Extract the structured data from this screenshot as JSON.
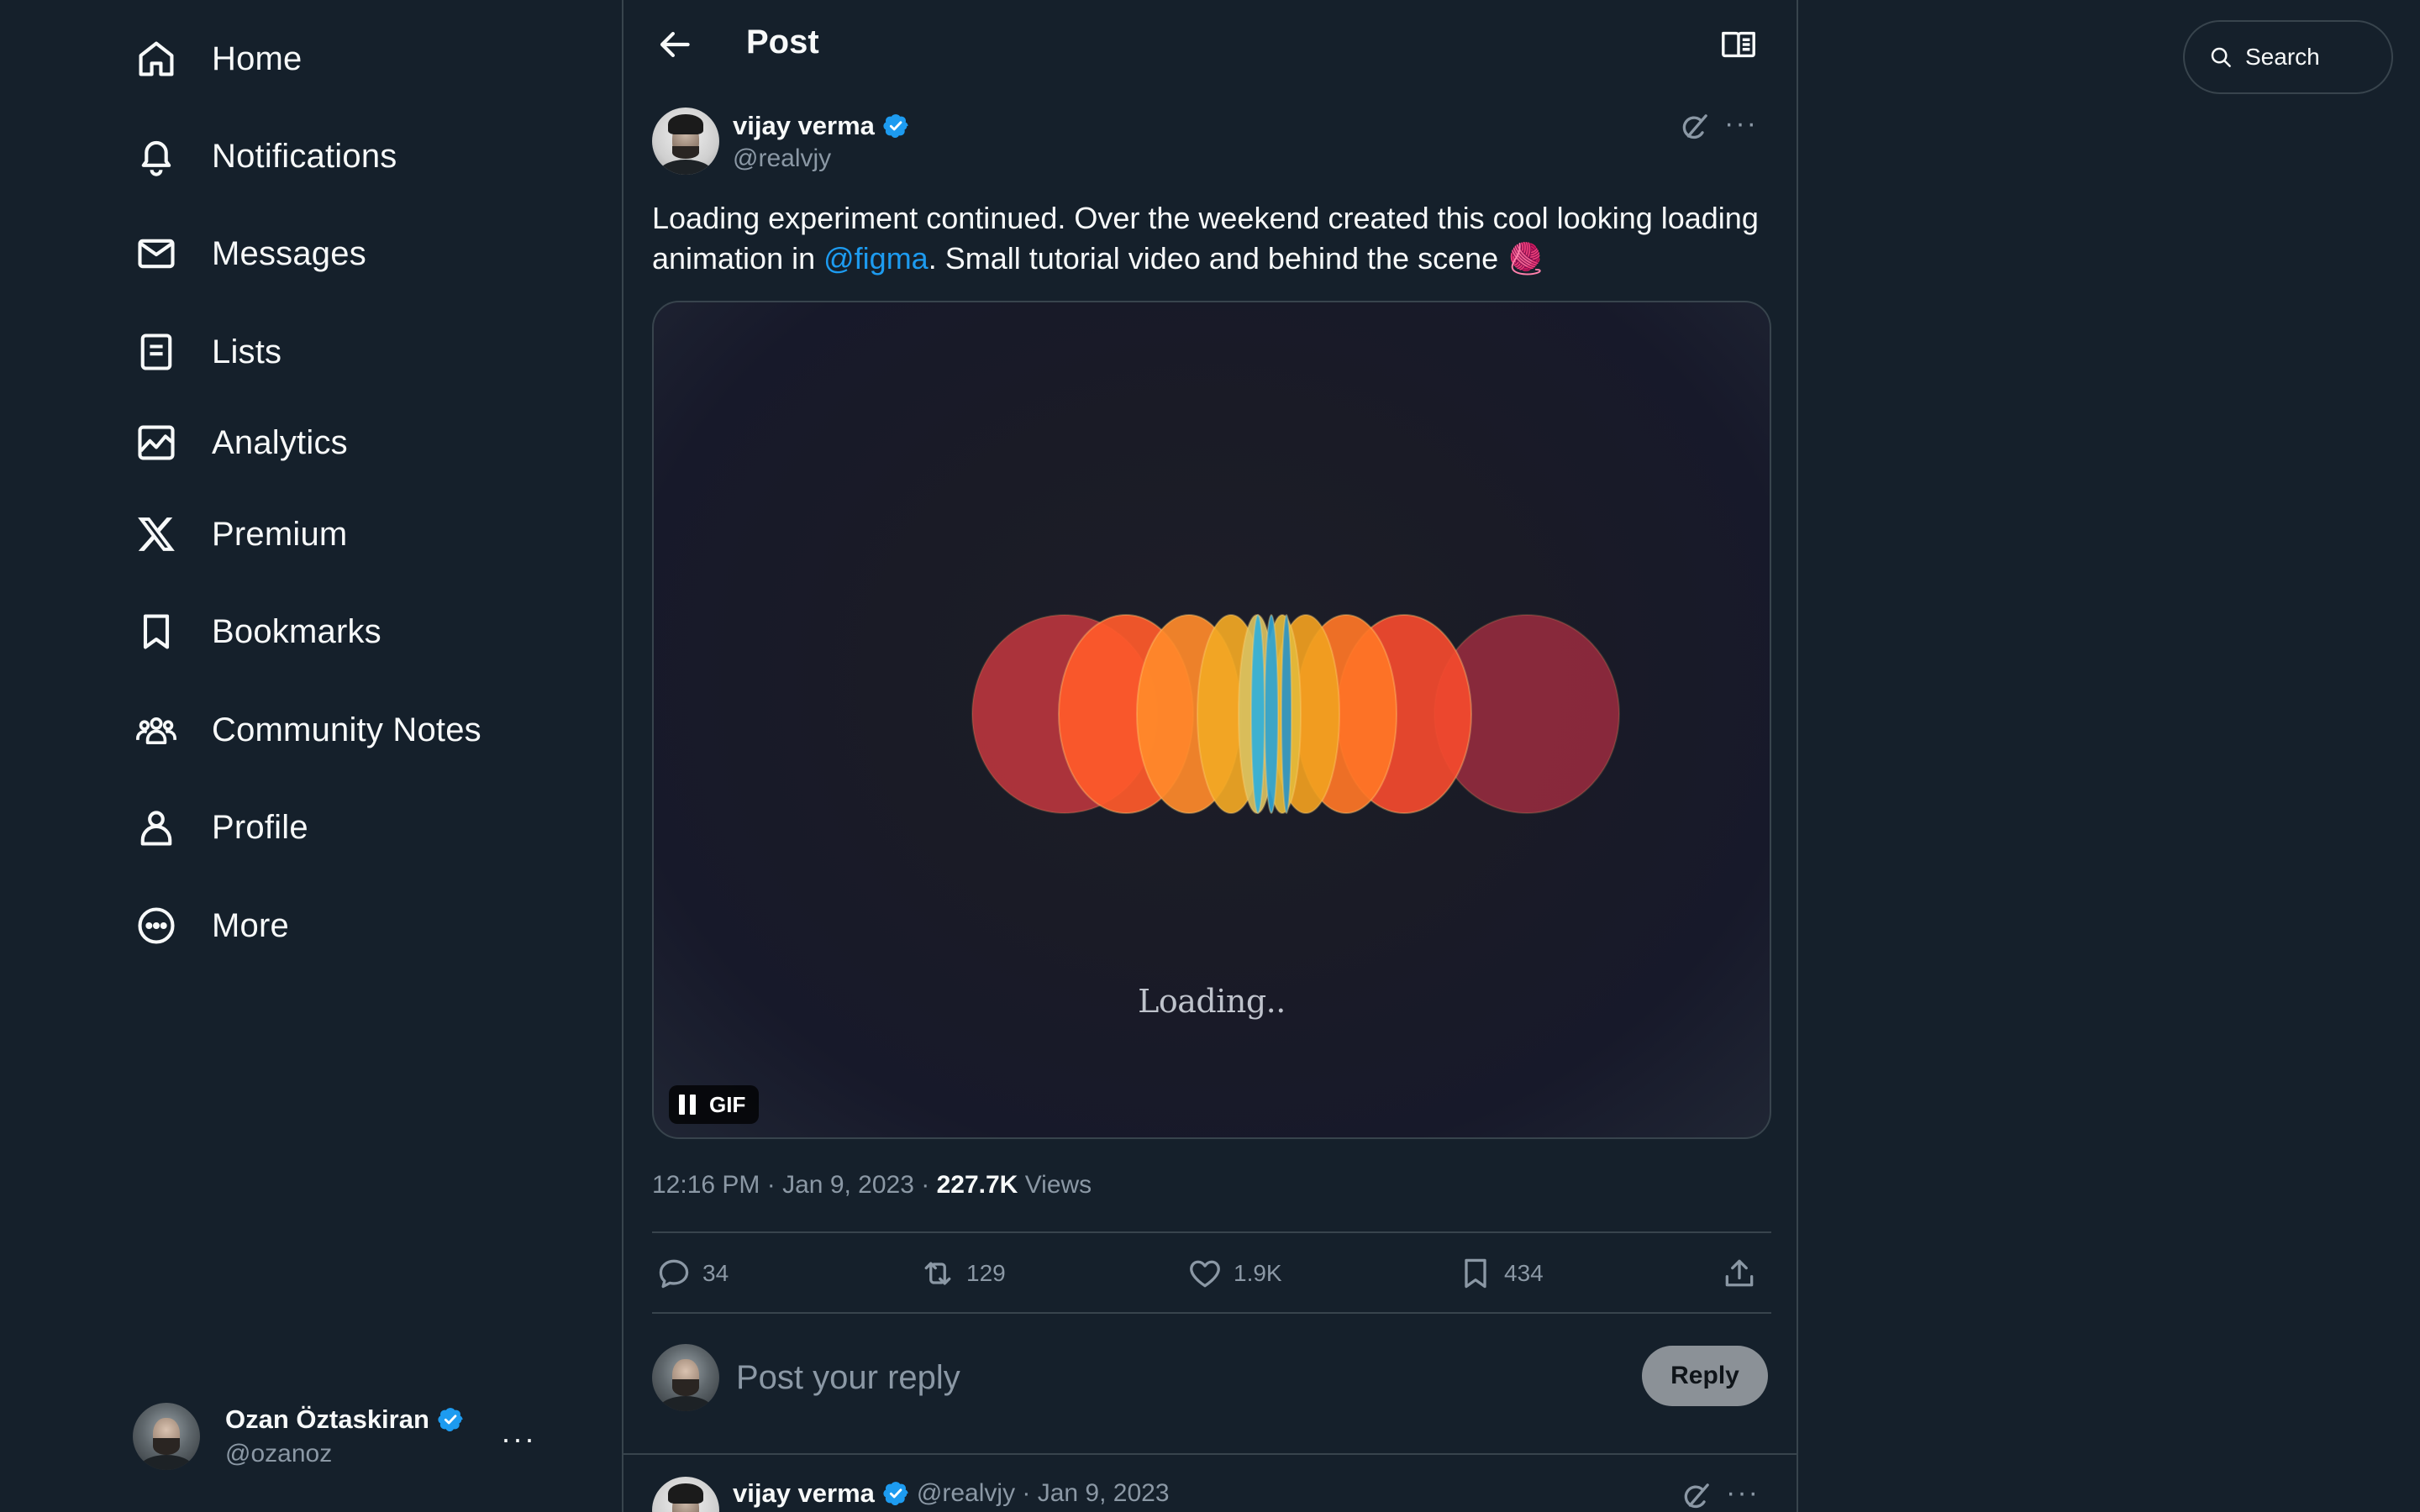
{
  "nav": {
    "items": [
      {
        "label": "Home",
        "icon": "home-icon"
      },
      {
        "label": "Notifications",
        "icon": "bell-icon"
      },
      {
        "label": "Messages",
        "icon": "envelope-icon"
      },
      {
        "label": "Lists",
        "icon": "list-icon"
      },
      {
        "label": "Analytics",
        "icon": "analytics-icon"
      },
      {
        "label": "Premium",
        "icon": "x-logo-icon"
      },
      {
        "label": "Bookmarks",
        "icon": "bookmark-icon"
      },
      {
        "label": "Community Notes",
        "icon": "community-icon"
      },
      {
        "label": "Profile",
        "icon": "person-icon"
      },
      {
        "label": "More",
        "icon": "more-circle-icon"
      }
    ]
  },
  "account": {
    "name": "Ozan Öztaskiran",
    "handle": "@ozanoz",
    "more": "···"
  },
  "header": {
    "title": "Post"
  },
  "tweet": {
    "author_name": "vijay verma",
    "author_handle": "@realvjy",
    "more": "···",
    "text_before": "Loading experiment continued. Over the weekend created this cool looking loading animation in ",
    "mention": "@figma",
    "text_after": ". Small tutorial video and behind the scene ",
    "emoji": "🧶",
    "media": {
      "caption": "Loading..",
      "badge": "GIF"
    },
    "time": "12:16 PM",
    "date": "Jan 9, 2023",
    "views_count": "227.7K",
    "views_label": "Views",
    "separator": "·",
    "stats": {
      "replies": "34",
      "reposts": "129",
      "likes": "1.9K",
      "bookmarks": "434"
    }
  },
  "reply": {
    "placeholder": "Post your reply",
    "button": "Reply"
  },
  "next_tweet": {
    "author_name": "vijay verma",
    "meta": "@realvjy · Jan 9, 2023",
    "more": "···"
  },
  "search": {
    "placeholder": "Search"
  },
  "colors": {
    "background": "#15202b",
    "border": "#38444d",
    "text_secondary": "#8b98a5",
    "accent": "#1d9bf0",
    "reply_button": "#8b9197"
  }
}
